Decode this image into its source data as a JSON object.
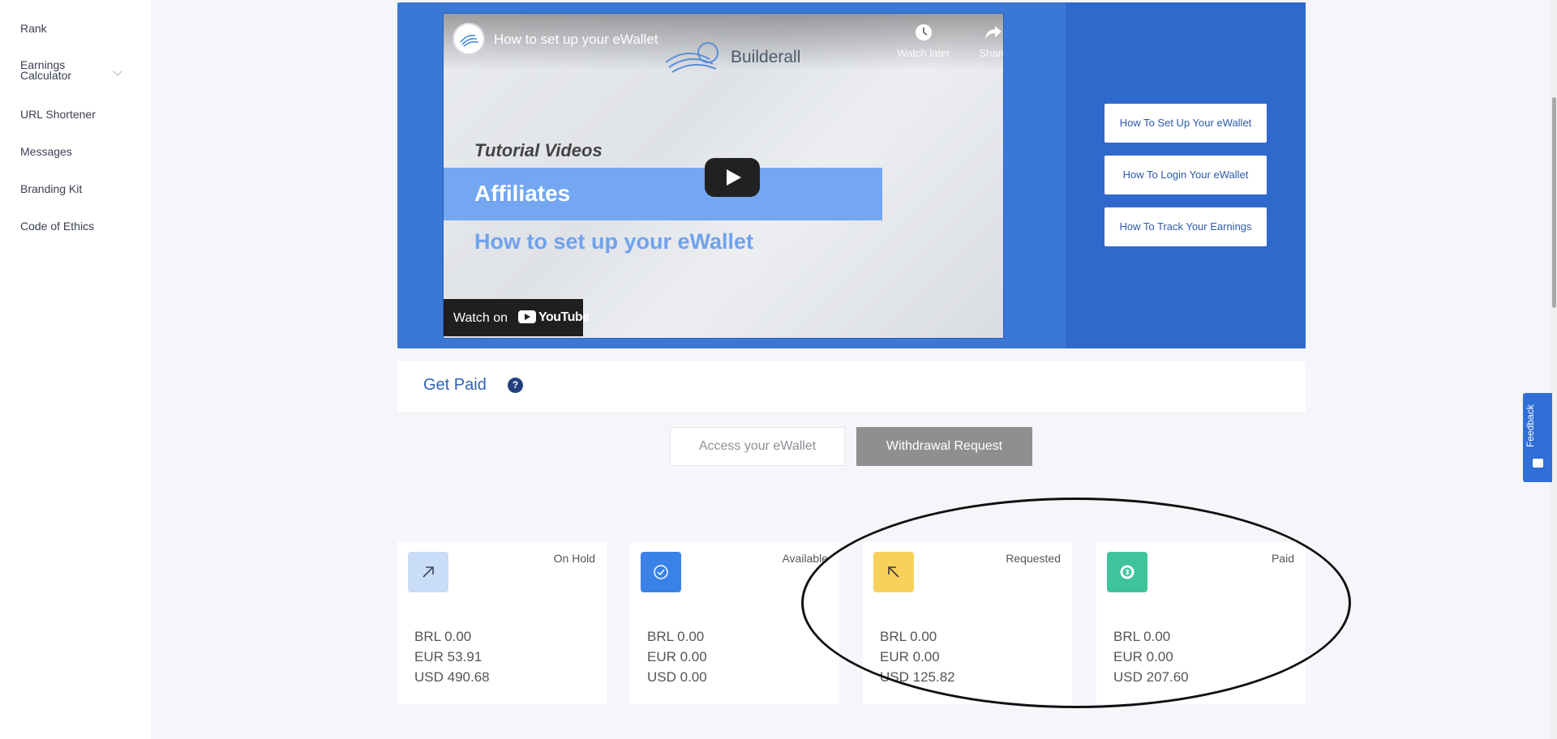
{
  "sidebar": {
    "items": [
      {
        "label": "Rank"
      },
      {
        "label": "Earnings\nCalculator"
      },
      {
        "label": "URL Shortener"
      },
      {
        "label": "Messages"
      },
      {
        "label": "Branding Kit"
      },
      {
        "label": "Code of Ethics"
      }
    ]
  },
  "video": {
    "title": "How to set up your eWallet",
    "brand": "Builderall",
    "watch_later": "Watch later",
    "share": "Share",
    "slide_heading": "Tutorial Videos",
    "slide_banner": "Affiliates",
    "slide_subtitle": "How to set up your eWallet",
    "watch_on": "Watch on",
    "youtube": "YouTube"
  },
  "video_links": [
    {
      "label": "How To Set Up Your eWallet"
    },
    {
      "label": "How To Login Your eWallet"
    },
    {
      "label": "How To Track Your Earnings"
    }
  ],
  "get_paid": {
    "title": "Get Paid",
    "help": "?",
    "access_button": "Access your eWallet",
    "withdraw_button": "Withdrawal Request"
  },
  "cards": [
    {
      "label": "On Hold",
      "icon": "arrow-up-right-icon",
      "color": "#c9dcf8",
      "lines": [
        "BRL 0.00",
        "EUR 53.91",
        "USD 490.68"
      ]
    },
    {
      "label": "Available",
      "icon": "check-circle-icon",
      "color": "#3b82e8",
      "lines": [
        "BRL 0.00",
        "EUR 0.00",
        "USD 0.00"
      ]
    },
    {
      "label": "Requested",
      "icon": "arrow-up-left-icon",
      "color": "#f8d05c",
      "lines": [
        "BRL 0.00",
        "EUR 0.00",
        "USD 125.82"
      ]
    },
    {
      "label": "Paid",
      "icon": "coin-icon",
      "color": "#3fc39c",
      "lines": [
        "BRL 0.00",
        "EUR 0.00",
        "USD 207.60"
      ]
    }
  ],
  "feedback": {
    "label": "Feedback"
  }
}
